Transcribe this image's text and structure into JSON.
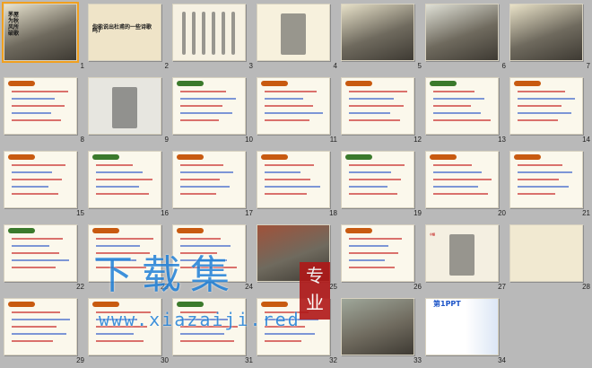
{
  "slides": [
    {
      "num": "1",
      "type": "photo",
      "bg": "#e8e3cf",
      "text": "茅屋为秋风所破歌"
    },
    {
      "num": "2",
      "type": "question",
      "bg": "#efe4c8",
      "text": "你能说出杜甫的一些诗歌吗?"
    },
    {
      "num": "3",
      "type": "calligraphy",
      "bg": "#f6f1e2",
      "text": ""
    },
    {
      "num": "4",
      "type": "portrait",
      "bg": "#f7f1dd",
      "text": ""
    },
    {
      "num": "5",
      "type": "photo",
      "bg": "#e6e0c8",
      "text": ""
    },
    {
      "num": "6",
      "type": "photo",
      "bg": "#dfe0d6",
      "text": ""
    },
    {
      "num": "7",
      "type": "photo-text",
      "bg": "#e9e2c8",
      "text": ""
    },
    {
      "num": "8",
      "type": "text",
      "bg": "#fbf8ec",
      "text": ""
    },
    {
      "num": "9",
      "type": "portrait",
      "bg": "#e7e6e0",
      "text": ""
    },
    {
      "num": "10",
      "type": "text",
      "bg": "#fbf8ec",
      "text": ""
    },
    {
      "num": "11",
      "type": "text",
      "bg": "#fbf8ec",
      "text": ""
    },
    {
      "num": "12",
      "type": "text",
      "bg": "#fbf8ec",
      "text": ""
    },
    {
      "num": "13",
      "type": "text",
      "bg": "#fbf8ec",
      "text": ""
    },
    {
      "num": "14",
      "type": "text",
      "bg": "#fbf8ec",
      "text": ""
    },
    {
      "num": "15",
      "type": "text",
      "bg": "#fbf8ec",
      "text": ""
    },
    {
      "num": "16",
      "type": "text",
      "bg": "#fbf8ec",
      "text": ""
    },
    {
      "num": "17",
      "type": "text",
      "bg": "#fbf8ec",
      "text": ""
    },
    {
      "num": "18",
      "type": "text",
      "bg": "#fbf8ec",
      "text": ""
    },
    {
      "num": "19",
      "type": "text",
      "bg": "#fbf8ec",
      "text": ""
    },
    {
      "num": "20",
      "type": "text",
      "bg": "#fbf8ec",
      "text": ""
    },
    {
      "num": "21",
      "type": "text",
      "bg": "#fbf8ec",
      "text": ""
    },
    {
      "num": "22",
      "type": "text",
      "bg": "#fbf8ec",
      "text": ""
    },
    {
      "num": "23",
      "type": "text",
      "bg": "#fbf8ec",
      "text": ""
    },
    {
      "num": "24",
      "type": "text",
      "bg": "#fbf8ec",
      "text": ""
    },
    {
      "num": "25",
      "type": "photo",
      "bg": "#a0523a",
      "text": ""
    },
    {
      "num": "26",
      "type": "text",
      "bg": "#fbf8ec",
      "text": ""
    },
    {
      "num": "27",
      "type": "portrait",
      "bg": "#f4efe1",
      "text": "小结"
    },
    {
      "num": "28",
      "type": "question",
      "bg": "#f1e9d1",
      "text": ""
    },
    {
      "num": "29",
      "type": "text",
      "bg": "#fbf8ec",
      "text": ""
    },
    {
      "num": "30",
      "type": "text",
      "bg": "#fbf8ec",
      "text": ""
    },
    {
      "num": "31",
      "type": "text",
      "bg": "#fbf8ec",
      "text": ""
    },
    {
      "num": "32",
      "type": "text",
      "bg": "#fbf8ec",
      "text": ""
    },
    {
      "num": "33",
      "type": "photo",
      "bg": "#9fa79a",
      "text": ""
    },
    {
      "num": "34",
      "type": "ppt",
      "bg": "#ffffff",
      "text": "第1PPT"
    }
  ],
  "watermark": {
    "main": "下载集",
    "badge": "专业",
    "url": "www.xiazaiji.red"
  }
}
